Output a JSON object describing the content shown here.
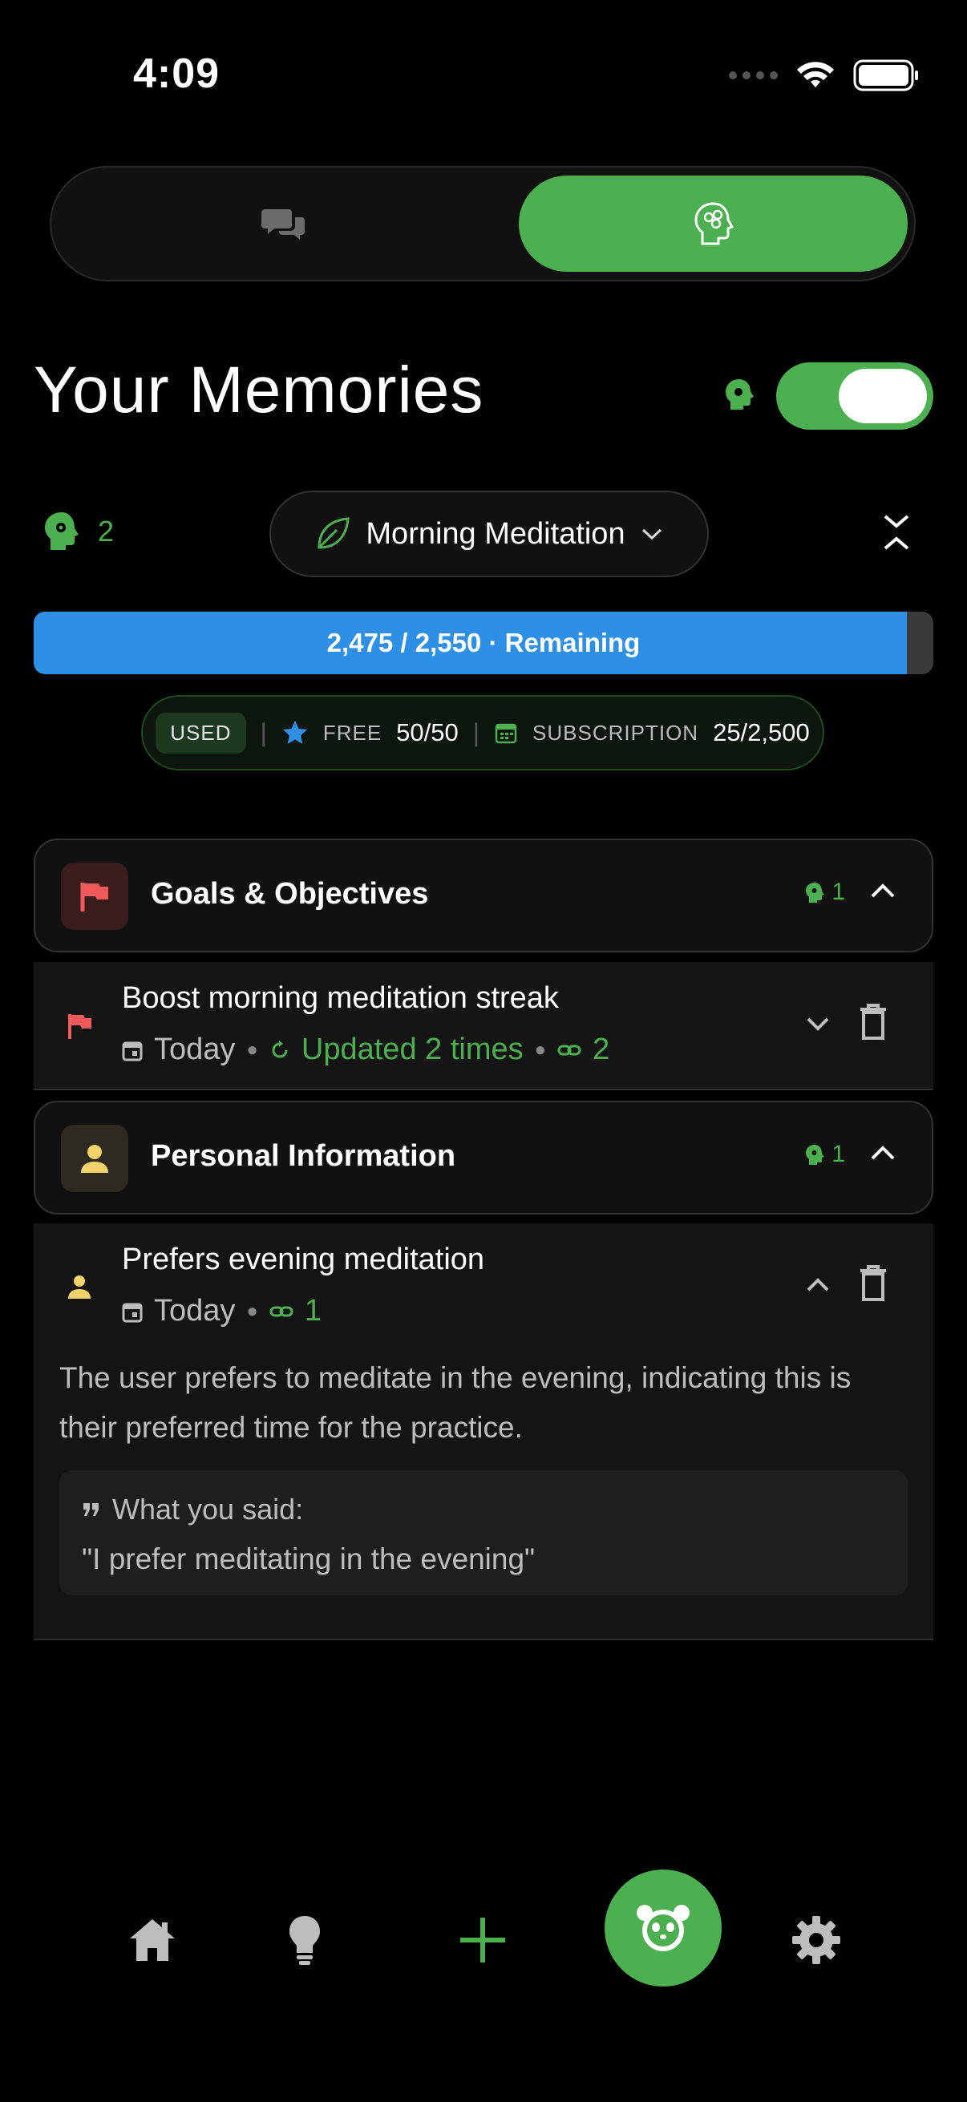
{
  "status_bar": {
    "time": "4:09"
  },
  "page": {
    "title": "Your Memories"
  },
  "filter": {
    "memory_count": "2",
    "topic": "Morning Meditation"
  },
  "progress": {
    "label": "2,475 / 2,550 · Remaining",
    "fraction": 0.9706
  },
  "usage": {
    "used_tag": "USED",
    "free_label": "FREE",
    "free_value": "50/50",
    "subscription_label": "SUBSCRIPTION",
    "subscription_value": "25/2,500"
  },
  "categories": [
    {
      "title": "Goals & Objectives",
      "count": "1",
      "memory": {
        "title": "Boost morning meditation streak",
        "date": "Today",
        "updated": "Updated 2 times",
        "links": "2"
      }
    },
    {
      "title": "Personal Information",
      "count": "1",
      "memory": {
        "title": "Prefers evening meditation",
        "date": "Today",
        "links": "1",
        "description": "The user prefers to meditate in the evening, indicating this is their preferred time for the practice.",
        "quote_label": "What you said:",
        "quote": "\"I prefer meditating in the evening\""
      }
    }
  ],
  "colors": {
    "accent": "#4caf50",
    "progress": "#2e8fe6",
    "goal_red": "#f05a5a",
    "personal_yellow": "#f5d36b"
  }
}
